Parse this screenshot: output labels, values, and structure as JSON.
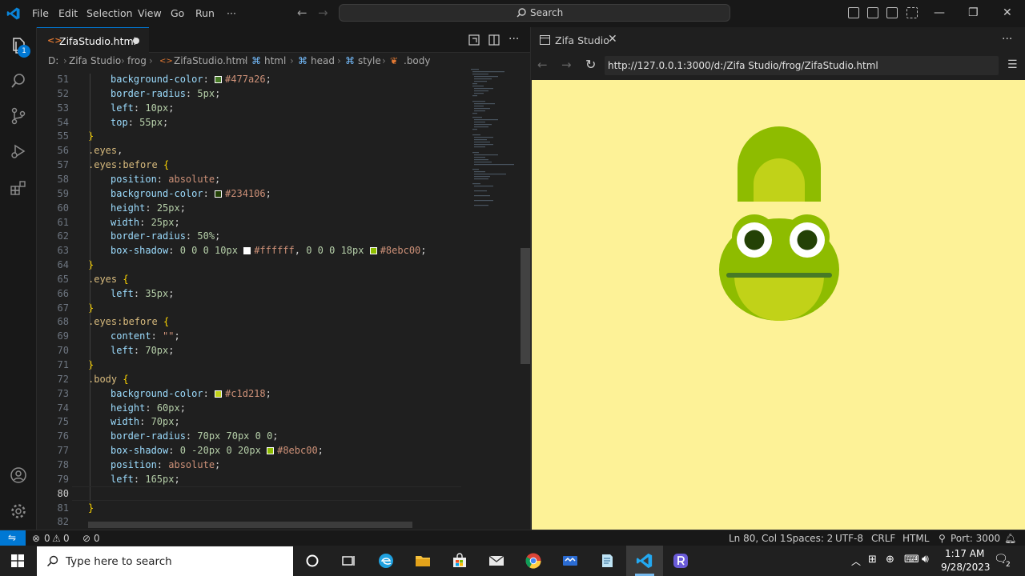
{
  "titlebar": {
    "menu": [
      "File",
      "Edit",
      "Selection",
      "View",
      "Go",
      "Run",
      "···"
    ],
    "search_label": "Search"
  },
  "activity": {
    "badge": "1"
  },
  "editor": {
    "tab_name": "ZifaStudio.html",
    "breadcrumb": [
      "D:",
      "Zifa Studio",
      "frog",
      "ZifaStudio.html",
      "html",
      "head",
      "style",
      ".body"
    ],
    "lines": [
      {
        "n": "51",
        "indent": 1,
        "parts": [
          [
            "prop",
            "background-color"
          ],
          [
            "p",
            ": "
          ],
          [
            "sw",
            "#477a26"
          ],
          [
            "val",
            "#477a26"
          ],
          [
            "p",
            ";"
          ]
        ]
      },
      {
        "n": "52",
        "indent": 1,
        "parts": [
          [
            "prop",
            "border-radius"
          ],
          [
            "p",
            ": "
          ],
          [
            "num",
            "5px"
          ],
          [
            "p",
            ";"
          ]
        ]
      },
      {
        "n": "53",
        "indent": 1,
        "parts": [
          [
            "prop",
            "left"
          ],
          [
            "p",
            ": "
          ],
          [
            "num",
            "10px"
          ],
          [
            "p",
            ";"
          ]
        ]
      },
      {
        "n": "54",
        "indent": 1,
        "parts": [
          [
            "prop",
            "top"
          ],
          [
            "p",
            ": "
          ],
          [
            "num",
            "55px"
          ],
          [
            "p",
            ";"
          ]
        ]
      },
      {
        "n": "55",
        "indent": 0,
        "parts": [
          [
            "brace",
            "}"
          ]
        ]
      },
      {
        "n": "56",
        "indent": 0,
        "parts": [
          [
            "sel",
            ".eyes"
          ],
          [
            "p",
            ","
          ]
        ]
      },
      {
        "n": "57",
        "indent": 0,
        "parts": [
          [
            "sel",
            ".eyes:before"
          ],
          [
            "p",
            " "
          ],
          [
            "brace",
            "{"
          ]
        ]
      },
      {
        "n": "58",
        "indent": 1,
        "parts": [
          [
            "prop",
            "position"
          ],
          [
            "p",
            ": "
          ],
          [
            "val",
            "absolute"
          ],
          [
            "p",
            ";"
          ]
        ]
      },
      {
        "n": "59",
        "indent": 1,
        "parts": [
          [
            "prop",
            "background-color"
          ],
          [
            "p",
            ": "
          ],
          [
            "sw",
            "#234106"
          ],
          [
            "val",
            "#234106"
          ],
          [
            "p",
            ";"
          ]
        ]
      },
      {
        "n": "60",
        "indent": 1,
        "parts": [
          [
            "prop",
            "height"
          ],
          [
            "p",
            ": "
          ],
          [
            "num",
            "25px"
          ],
          [
            "p",
            ";"
          ]
        ]
      },
      {
        "n": "61",
        "indent": 1,
        "parts": [
          [
            "prop",
            "width"
          ],
          [
            "p",
            ": "
          ],
          [
            "num",
            "25px"
          ],
          [
            "p",
            ";"
          ]
        ]
      },
      {
        "n": "62",
        "indent": 1,
        "parts": [
          [
            "prop",
            "border-radius"
          ],
          [
            "p",
            ": "
          ],
          [
            "num",
            "50%"
          ],
          [
            "p",
            ";"
          ]
        ]
      },
      {
        "n": "63",
        "indent": 1,
        "parts": [
          [
            "prop",
            "box-shadow"
          ],
          [
            "p",
            ": "
          ],
          [
            "num",
            "0 0 0 10px"
          ],
          [
            "p",
            " "
          ],
          [
            "sw",
            "#ffffff"
          ],
          [
            "val",
            "#ffffff"
          ],
          [
            "p",
            ", "
          ],
          [
            "num",
            "0 0 0 18px"
          ],
          [
            "p",
            " "
          ],
          [
            "sw",
            "#8ebc00"
          ],
          [
            "val",
            "#8ebc00"
          ],
          [
            "p",
            ";"
          ]
        ]
      },
      {
        "n": "64",
        "indent": 0,
        "parts": [
          [
            "brace",
            "}"
          ]
        ]
      },
      {
        "n": "65",
        "indent": 0,
        "parts": [
          [
            "sel",
            ".eyes"
          ],
          [
            "p",
            " "
          ],
          [
            "brace",
            "{"
          ]
        ]
      },
      {
        "n": "66",
        "indent": 1,
        "parts": [
          [
            "prop",
            "left"
          ],
          [
            "p",
            ": "
          ],
          [
            "num",
            "35px"
          ],
          [
            "p",
            ";"
          ]
        ]
      },
      {
        "n": "67",
        "indent": 0,
        "parts": [
          [
            "brace",
            "}"
          ]
        ]
      },
      {
        "n": "68",
        "indent": 0,
        "parts": [
          [
            "sel",
            ".eyes:before"
          ],
          [
            "p",
            " "
          ],
          [
            "brace",
            "{"
          ]
        ]
      },
      {
        "n": "69",
        "indent": 1,
        "parts": [
          [
            "prop",
            "content"
          ],
          [
            "p",
            ": "
          ],
          [
            "val",
            "\"\""
          ],
          [
            "p",
            ";"
          ]
        ]
      },
      {
        "n": "70",
        "indent": 1,
        "parts": [
          [
            "prop",
            "left"
          ],
          [
            "p",
            ": "
          ],
          [
            "num",
            "70px"
          ],
          [
            "p",
            ";"
          ]
        ]
      },
      {
        "n": "71",
        "indent": 0,
        "parts": [
          [
            "brace",
            "}"
          ]
        ]
      },
      {
        "n": "72",
        "indent": 0,
        "parts": [
          [
            "sel",
            ".body"
          ],
          [
            "p",
            " "
          ],
          [
            "brace",
            "{"
          ]
        ]
      },
      {
        "n": "73",
        "indent": 1,
        "parts": [
          [
            "prop",
            "background-color"
          ],
          [
            "p",
            ": "
          ],
          [
            "sw",
            "#c1d218"
          ],
          [
            "val",
            "#c1d218"
          ],
          [
            "p",
            ";"
          ]
        ]
      },
      {
        "n": "74",
        "indent": 1,
        "parts": [
          [
            "prop",
            "height"
          ],
          [
            "p",
            ": "
          ],
          [
            "num",
            "60px"
          ],
          [
            "p",
            ";"
          ]
        ]
      },
      {
        "n": "75",
        "indent": 1,
        "parts": [
          [
            "prop",
            "width"
          ],
          [
            "p",
            ": "
          ],
          [
            "num",
            "70px"
          ],
          [
            "p",
            ";"
          ]
        ]
      },
      {
        "n": "76",
        "indent": 1,
        "parts": [
          [
            "prop",
            "border-radius"
          ],
          [
            "p",
            ": "
          ],
          [
            "num",
            "70px 70px 0 0"
          ],
          [
            "p",
            ";"
          ]
        ]
      },
      {
        "n": "77",
        "indent": 1,
        "parts": [
          [
            "prop",
            "box-shadow"
          ],
          [
            "p",
            ": "
          ],
          [
            "num",
            "0 -20px 0 20px"
          ],
          [
            "p",
            " "
          ],
          [
            "sw",
            "#8ebc00"
          ],
          [
            "val",
            "#8ebc00"
          ],
          [
            "p",
            ";"
          ]
        ]
      },
      {
        "n": "78",
        "indent": 1,
        "parts": [
          [
            "prop",
            "position"
          ],
          [
            "p",
            ": "
          ],
          [
            "val",
            "absolute"
          ],
          [
            "p",
            ";"
          ]
        ]
      },
      {
        "n": "79",
        "indent": 1,
        "parts": [
          [
            "prop",
            "left"
          ],
          [
            "p",
            ": "
          ],
          [
            "num",
            "165px"
          ],
          [
            "p",
            ";"
          ]
        ]
      },
      {
        "n": "80",
        "indent": 1,
        "parts": []
      },
      {
        "n": "81",
        "indent": 0,
        "parts": [
          [
            "brace",
            "}"
          ]
        ]
      },
      {
        "n": "82",
        "indent": 0,
        "parts": []
      }
    ]
  },
  "browser": {
    "tab_title": "Zifa Studio",
    "url": "http://127.0.0.1:3000/d:/Zifa Studio/frog/ZifaStudio.html",
    "colors": {
      "background": "#fdf297",
      "frog_light": "#c1d218",
      "frog_dark": "#8ebc00",
      "mouth": "#477a26",
      "pupil": "#234106"
    }
  },
  "statusbar": {
    "errors": "0",
    "warnings": "0",
    "ports": "0",
    "position": "Ln 80, Col 1",
    "spaces": "Spaces: 2",
    "encoding": "UTF-8",
    "eol": "CRLF",
    "language": "HTML",
    "port": "Port: 3000"
  },
  "taskbar": {
    "search_placeholder": "Type here to search",
    "time": "1:17 AM",
    "date": "9/28/2023",
    "notifications": "2"
  }
}
